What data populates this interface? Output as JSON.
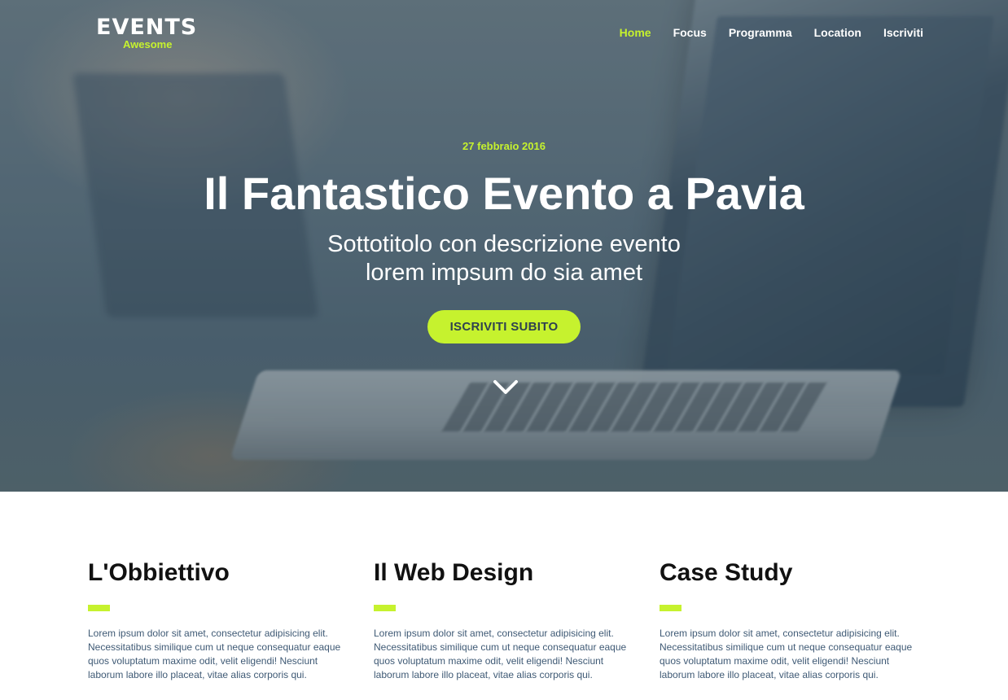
{
  "brand": {
    "name": "EVENTS",
    "tagline": "Awesome"
  },
  "nav": {
    "items": [
      {
        "label": "Home",
        "active": true
      },
      {
        "label": "Focus",
        "active": false
      },
      {
        "label": "Programma",
        "active": false
      },
      {
        "label": "Location",
        "active": false
      },
      {
        "label": "Iscriviti",
        "active": false
      }
    ]
  },
  "hero": {
    "date": "27 febbraio 2016",
    "title": "Il Fantastico Evento a Pavia",
    "subtitle_line1": "Sottotitolo con descrizione evento",
    "subtitle_line2": "lorem impsum do sia amet",
    "cta_label": "ISCRIVITI SUBITO",
    "scroll_icon": "chevron-down-icon"
  },
  "features": [
    {
      "title": "L'Obbiettivo",
      "text": "Lorem ipsum dolor sit amet, consectetur adipisicing elit. Necessitatibus similique cum ut neque consequatur eaque quos voluptatum maxime odit, velit eligendi! Nesciunt laborum labore illo placeat, vitae alias corporis qui."
    },
    {
      "title": "Il Web Design",
      "text": "Lorem ipsum dolor sit amet, consectetur adipisicing elit. Necessitatibus similique cum ut neque consequatur eaque quos voluptatum maxime odit, velit eligendi! Nesciunt laborum labore illo placeat, vitae alias corporis qui."
    },
    {
      "title": "Case Study",
      "text": "Lorem ipsum dolor sit amet, consectetur adipisicing elit. Necessitatibus similique cum ut neque consequatur eaque quos voluptatum maxime odit, velit eligendi! Nesciunt laborum labore illo placeat, vitae alias corporis qui."
    }
  ],
  "colors": {
    "accent": "#c6f22e",
    "text_dark": "#111111",
    "body_text": "#3f5a75",
    "button_text": "#2e4050"
  }
}
